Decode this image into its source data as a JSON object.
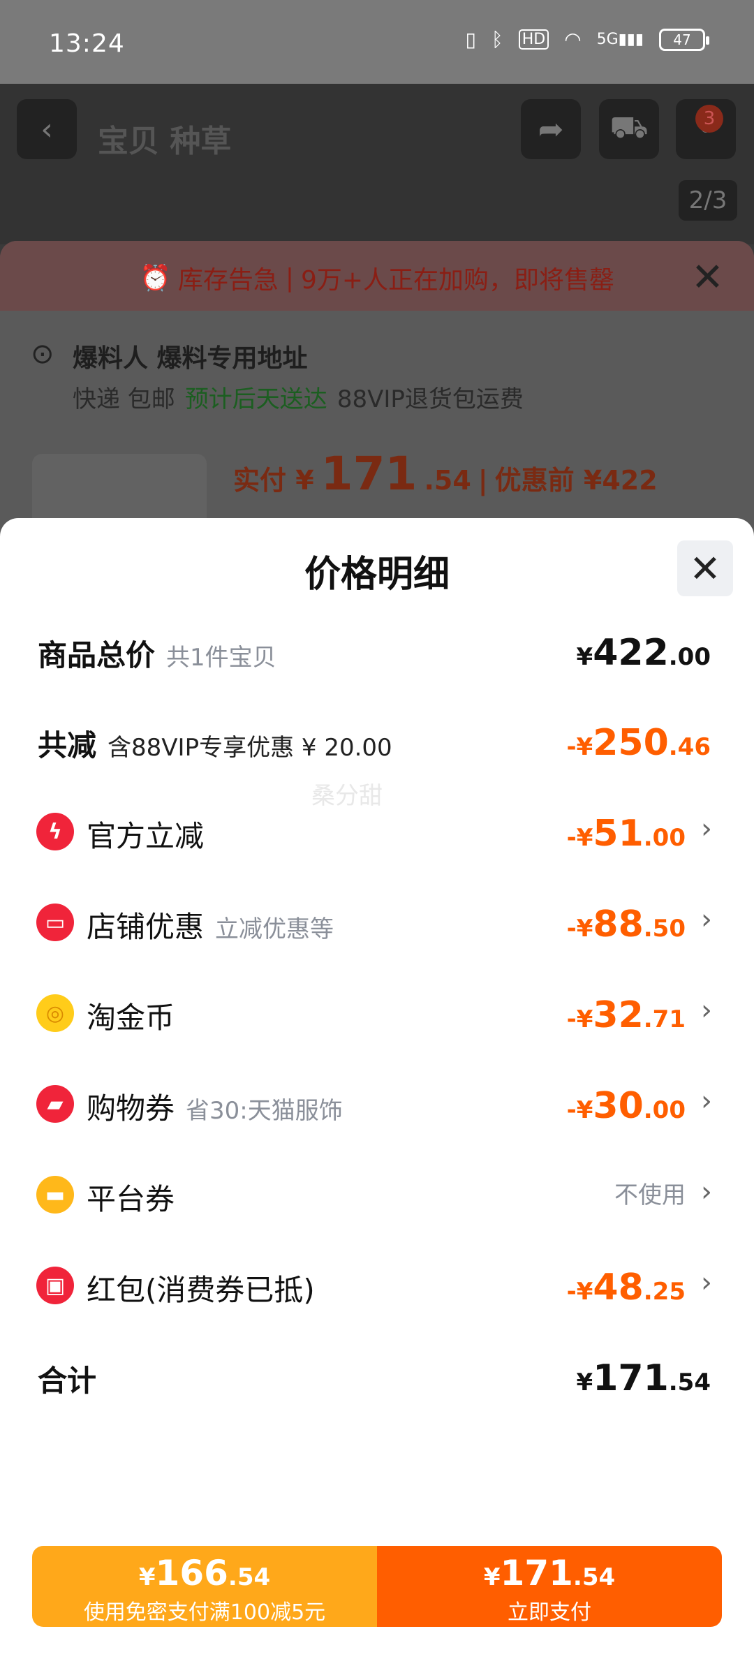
{
  "status_bar": {
    "time": "13:24",
    "battery": "47",
    "signal": "5G",
    "hd": "HD"
  },
  "background": {
    "tab_text": "宝贝 种草",
    "cart_badge": "3",
    "pager": "2/3",
    "stock_alert": "库存告急",
    "stock_msg": "9万+人正在加购，即将售罄",
    "address_name": "爆料人 爆料专用地址",
    "delivery": "快递 包邮",
    "eta": "预计后天送达",
    "return_info": "88VIP退货包运费",
    "paid_label": "实付 ¥",
    "paid_int": "171",
    "paid_dec": ".54",
    "before_label": "优惠前 ¥422"
  },
  "modal": {
    "title": "价格明细",
    "watermark": "桑分甜",
    "total_price": {
      "label": "商品总价",
      "sub": "共1件宝贝",
      "cur": "¥",
      "int": "422",
      "dec": ".00"
    },
    "total_discount": {
      "label": "共减",
      "sub": "含88VIP专享优惠 ¥ 20.00",
      "cur": "-¥",
      "int": "250",
      "dec": ".46"
    },
    "items": [
      {
        "label": "官方立减",
        "sub": "",
        "cur": "-¥",
        "int": "51",
        "dec": ".00",
        "icon": "lightning-icon",
        "color": "#f0243a"
      },
      {
        "label": "店铺优惠",
        "sub": "立减优惠等",
        "cur": "-¥",
        "int": "88",
        "dec": ".50",
        "icon": "shop-icon",
        "color": "#f0243a"
      },
      {
        "label": "淘金币",
        "sub": "",
        "cur": "-¥",
        "int": "32",
        "dec": ".71",
        "icon": "coin-icon",
        "color": "#ffcc1a"
      },
      {
        "label": "购物券",
        "sub": "省30:天猫服饰",
        "cur": "-¥",
        "int": "30",
        "dec": ".00",
        "icon": "ticket-icon",
        "color": "#f0243a"
      },
      {
        "label": "平台券",
        "sub": "",
        "unused": "不使用",
        "icon": "coupon-icon",
        "color": "#ffb81a"
      },
      {
        "label": "红包(消费券已抵)",
        "sub": "",
        "cur": "-¥",
        "int": "48",
        "dec": ".25",
        "icon": "red-envelope-icon",
        "color": "#f0243a"
      }
    ],
    "sum": {
      "label": "合计",
      "cur": "¥",
      "int": "171",
      "dec": ".54"
    }
  },
  "buttons": {
    "left": {
      "cur": "¥",
      "int": "166",
      "dec": ".54",
      "sub": "使用免密支付满100减5元"
    },
    "right": {
      "cur": "¥",
      "int": "171",
      "dec": ".54",
      "sub": "立即支付"
    }
  },
  "colors": {
    "accent_orange": "#ff5e00",
    "accent_yellow": "#ffa81a"
  }
}
